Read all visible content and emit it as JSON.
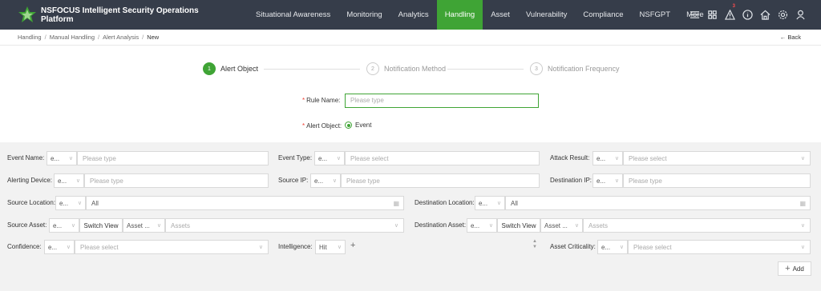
{
  "app": {
    "title_line1": "NSFOCUS Intelligent Security Operations",
    "title_line2": "Platform"
  },
  "nav": [
    "Situational Awareness",
    "Monitoring",
    "Analytics",
    "Handling",
    "Asset",
    "Vulnerability",
    "Compliance",
    "NSFGPT",
    "More"
  ],
  "nav_active": "Handling",
  "alert_badge": "3",
  "breadcrumb": {
    "items": [
      "Handling",
      "Manual Handling",
      "Alert Analysis",
      "New"
    ],
    "sep": "/"
  },
  "back_label": "Back",
  "steps": [
    {
      "num": "1",
      "label": "Alert Object",
      "active": true
    },
    {
      "num": "2",
      "label": "Notification Method",
      "active": false
    },
    {
      "num": "3",
      "label": "Notification Frequency",
      "active": false
    }
  ],
  "form": {
    "rule_name_label": "Rule Name:",
    "rule_name_placeholder": "Please type",
    "alert_object_label": "Alert Object:",
    "alert_object_value": "Event"
  },
  "filters": {
    "event_name": {
      "label": "Event Name:",
      "op": "e...",
      "placeholder": "Please type"
    },
    "event_type": {
      "label": "Event Type:",
      "op": "e...",
      "placeholder": "Please select"
    },
    "attack_result": {
      "label": "Attack Result:",
      "op": "e...",
      "placeholder": "Please select"
    },
    "alerting_device": {
      "label": "Alerting Device:",
      "op": "e...",
      "placeholder": "Please type"
    },
    "source_ip": {
      "label": "Source IP:",
      "op": "e...",
      "placeholder": "Please type"
    },
    "destination_ip": {
      "label": "Destination IP:",
      "op": "e...",
      "placeholder": "Please type"
    },
    "source_location": {
      "label": "Source Location:",
      "op": "e...",
      "value": "All"
    },
    "destination_location": {
      "label": "Destination Location:",
      "op": "e...",
      "value": "All"
    },
    "source_asset": {
      "label": "Source Asset:",
      "op": "e...",
      "view": "Switch View",
      "type": "Asset ...",
      "placeholder": "Assets"
    },
    "destination_asset": {
      "label": "Destination Asset:",
      "op": "e...",
      "view": "Switch View",
      "type": "Asset ...",
      "placeholder": "Assets"
    },
    "confidence": {
      "label": "Confidence:",
      "op": "e...",
      "placeholder": "Please select"
    },
    "intelligence": {
      "label": "Intelligence:",
      "value": "Hit"
    },
    "asset_criticality": {
      "label": "Asset Criticality:",
      "op": "e...",
      "placeholder": "Please select"
    }
  },
  "add_label": "Add",
  "colors": {
    "accent": "#3fa435",
    "topbar": "#363d4a"
  }
}
